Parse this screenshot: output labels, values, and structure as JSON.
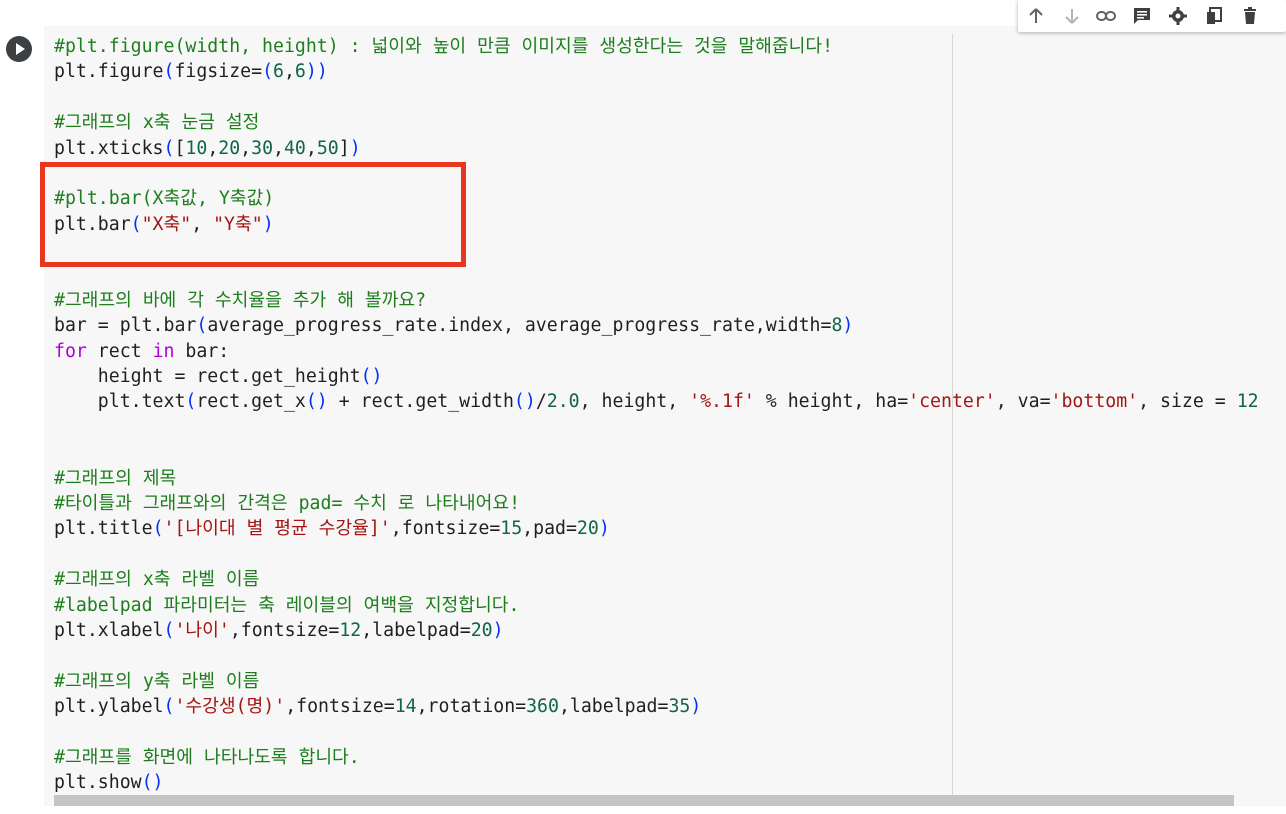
{
  "toolbar": {
    "icons": [
      "arrow-up-icon",
      "arrow-down-icon",
      "link-icon",
      "comment-icon",
      "gear-icon",
      "mirror-cell-icon",
      "trash-icon"
    ]
  },
  "code_lines": [
    [
      {
        "t": "#plt.figure(width, height) : 넓이와 높이 만큼 이미지를 생성한다는 것을 말해줍니다!",
        "c": "c"
      }
    ],
    [
      {
        "t": "plt.figure"
      },
      {
        "t": "(",
        "c": "p"
      },
      {
        "t": "figsize="
      },
      {
        "t": "(",
        "c": "p"
      },
      {
        "t": "6",
        "c": "n"
      },
      {
        "t": ","
      },
      {
        "t": "6",
        "c": "n"
      },
      {
        "t": ")",
        "c": "p"
      },
      {
        "t": ")",
        "c": "p"
      }
    ],
    [],
    [
      {
        "t": "#그래프의 x축 눈금 설정",
        "c": "c"
      }
    ],
    [
      {
        "t": "plt.xticks"
      },
      {
        "t": "(",
        "c": "p"
      },
      {
        "t": "["
      },
      {
        "t": "10",
        "c": "n"
      },
      {
        "t": ","
      },
      {
        "t": "20",
        "c": "n"
      },
      {
        "t": ","
      },
      {
        "t": "30",
        "c": "n"
      },
      {
        "t": ","
      },
      {
        "t": "40",
        "c": "n"
      },
      {
        "t": ","
      },
      {
        "t": "50",
        "c": "n"
      },
      {
        "t": "]"
      },
      {
        "t": ")",
        "c": "p"
      }
    ],
    [],
    [
      {
        "t": "#plt.bar(X축값, Y축값)",
        "c": "c"
      }
    ],
    [
      {
        "t": "plt.bar"
      },
      {
        "t": "(",
        "c": "p"
      },
      {
        "t": "\"X축\"",
        "c": "s"
      },
      {
        "t": ", "
      },
      {
        "t": "\"Y축\"",
        "c": "s"
      },
      {
        "t": ")",
        "c": "p"
      }
    ],
    [],
    [],
    [
      {
        "t": "#그래프의 바에 각 수치율을 추가 해 볼까요?",
        "c": "c"
      }
    ],
    [
      {
        "t": "bar = plt.bar"
      },
      {
        "t": "(",
        "c": "p"
      },
      {
        "t": "average_progress_rate.index, average_progress_rate,width="
      },
      {
        "t": "8",
        "c": "n"
      },
      {
        "t": ")",
        "c": "p"
      }
    ],
    [
      {
        "t": "for",
        "c": "k"
      },
      {
        "t": " rect "
      },
      {
        "t": "in",
        "c": "k"
      },
      {
        "t": " bar:"
      }
    ],
    [
      {
        "t": "    height = rect.get_height"
      },
      {
        "t": "()",
        "c": "p"
      }
    ],
    [
      {
        "t": "    plt.text"
      },
      {
        "t": "(",
        "c": "p"
      },
      {
        "t": "rect.get_x"
      },
      {
        "t": "()",
        "c": "p"
      },
      {
        "t": " + rect.get_width"
      },
      {
        "t": "()",
        "c": "p"
      },
      {
        "t": "/"
      },
      {
        "t": "2.0",
        "c": "n"
      },
      {
        "t": ", height, "
      },
      {
        "t": "'%.1f'",
        "c": "s"
      },
      {
        "t": " % height, ha="
      },
      {
        "t": "'center'",
        "c": "s"
      },
      {
        "t": ", va="
      },
      {
        "t": "'bottom'",
        "c": "s"
      },
      {
        "t": ", size = "
      },
      {
        "t": "12",
        "c": "n"
      }
    ],
    [],
    [],
    [
      {
        "t": "#그래프의 제목",
        "c": "c"
      }
    ],
    [
      {
        "t": "#타이틀과 그래프와의 간격은 pad= 수치 로 나타내어요!",
        "c": "c"
      }
    ],
    [
      {
        "t": "plt.title"
      },
      {
        "t": "(",
        "c": "p"
      },
      {
        "t": "'[나이대 별 평균 수강율]'",
        "c": "s"
      },
      {
        "t": ",fontsize="
      },
      {
        "t": "15",
        "c": "n"
      },
      {
        "t": ",pad="
      },
      {
        "t": "20",
        "c": "n"
      },
      {
        "t": ")",
        "c": "p"
      }
    ],
    [],
    [
      {
        "t": "#그래프의 x축 라벨 이름",
        "c": "c"
      }
    ],
    [
      {
        "t": "#labelpad 파라미터는 축 레이블의 여백을 지정합니다.",
        "c": "c"
      }
    ],
    [
      {
        "t": "plt.xlabel"
      },
      {
        "t": "(",
        "c": "p"
      },
      {
        "t": "'나이'",
        "c": "s"
      },
      {
        "t": ",fontsize="
      },
      {
        "t": "12",
        "c": "n"
      },
      {
        "t": ",labelpad="
      },
      {
        "t": "20",
        "c": "n"
      },
      {
        "t": ")",
        "c": "p"
      }
    ],
    [],
    [
      {
        "t": "#그래프의 y축 라벨 이름",
        "c": "c"
      }
    ],
    [
      {
        "t": "plt.ylabel"
      },
      {
        "t": "(",
        "c": "p"
      },
      {
        "t": "'수강생(명)'",
        "c": "s"
      },
      {
        "t": ",fontsize="
      },
      {
        "t": "14",
        "c": "n"
      },
      {
        "t": ",rotation="
      },
      {
        "t": "360",
        "c": "n"
      },
      {
        "t": ",labelpad="
      },
      {
        "t": "35",
        "c": "n"
      },
      {
        "t": ")",
        "c": "p"
      }
    ],
    [],
    [
      {
        "t": "#그래프를 화면에 나타나도록 합니다.",
        "c": "c"
      }
    ],
    [
      {
        "t": "plt.show"
      },
      {
        "t": "()",
        "c": "p"
      }
    ]
  ],
  "colors": {
    "comment": "#1e7e1e",
    "string": "#a31515",
    "number": "#116644",
    "keyword": "#af00db",
    "paren": "#0431fa",
    "highlight_box": "#e8371e"
  }
}
